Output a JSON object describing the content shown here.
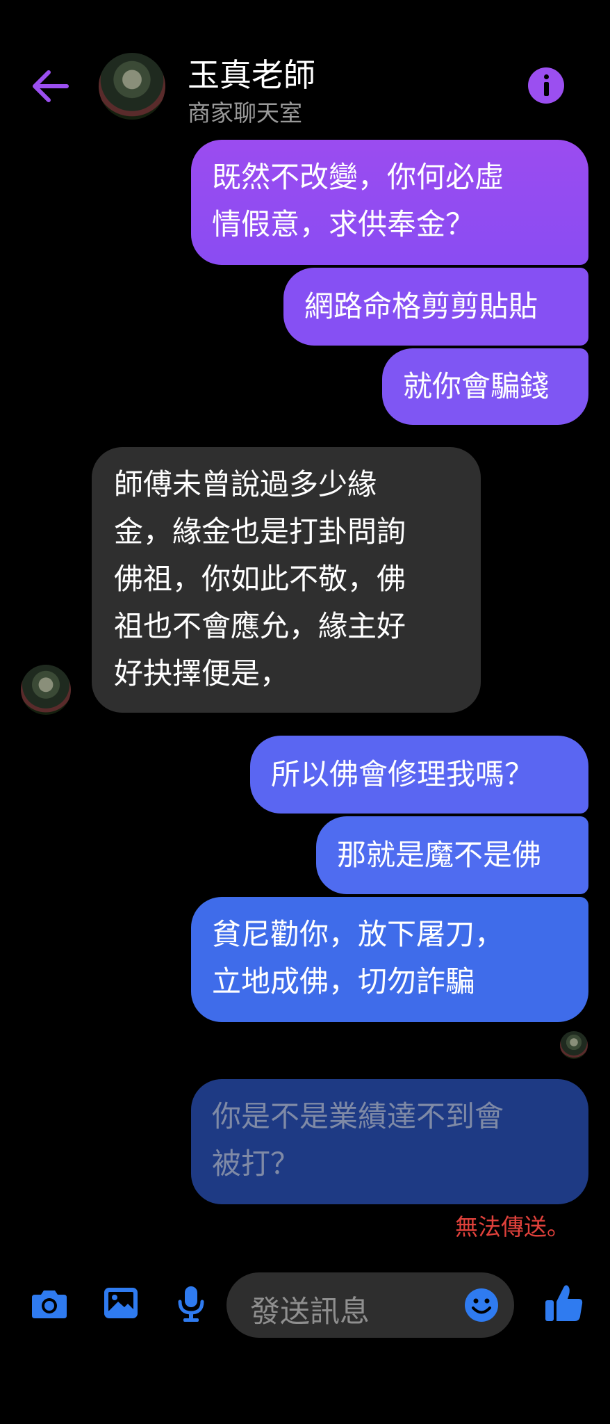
{
  "header": {
    "back_icon": "arrow-left-icon",
    "title": "玉真老師",
    "subtitle": "商家聊天室",
    "info_icon": "info-icon",
    "accent": "#9b4ff0"
  },
  "messages": [
    {
      "from": "me",
      "text": "既然不改變，你何必虛\n情假意，求供奉金？"
    },
    {
      "from": "me",
      "text": "網路命格剪剪貼貼"
    },
    {
      "from": "me",
      "text": "就你會騙錢"
    },
    {
      "from": "them",
      "text": "師傅未曾說過多少緣\n金，緣金也是打卦問詢\n佛祖，你如此不敬，佛\n祖也不會應允，緣主好\n好抉擇便是，"
    },
    {
      "from": "me",
      "text": "所以佛會修理我嗎？"
    },
    {
      "from": "me",
      "text": "那就是魔不是佛"
    },
    {
      "from": "me",
      "text": "貧尼勸你，放下屠刀，\n立地成佛，切勿詐騙"
    },
    {
      "from": "me",
      "status": "failed",
      "text": "你是不是業績達不到會\n被打？"
    }
  ],
  "failed_text": "無法傳送。",
  "composer": {
    "placeholder": "發送訊息",
    "camera_icon": "camera-icon",
    "image_icon": "image-icon",
    "mic_icon": "microphone-icon",
    "emoji_icon": "emoji-icon",
    "like_icon": "thumbs-up-icon",
    "icon_color": "#2f7bf0"
  }
}
